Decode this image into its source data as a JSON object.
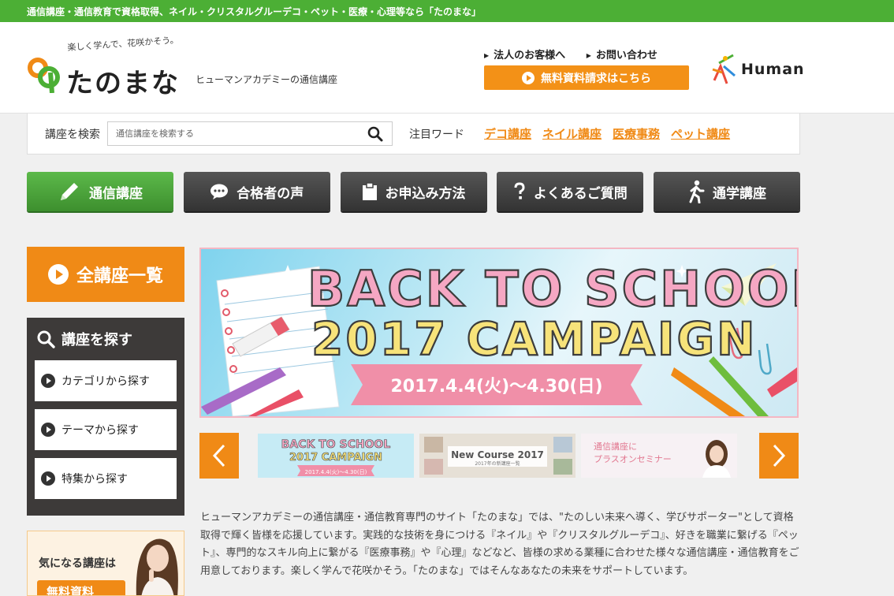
{
  "topbar": {
    "text": "通信講座・通信教育で資格取得、ネイル・クリスタルグルーデコ・ペット・医療・心理等なら「たのまな」"
  },
  "header": {
    "tagline": "楽しく学んで、花咲かそう。",
    "brand": "たのまな",
    "brand_sub": "ヒューマンアカデミーの通信講座",
    "links": [
      {
        "label": "法人のお客様へ"
      },
      {
        "label": "お問い合わせ"
      }
    ],
    "request_button": "無料資料請求はこちら",
    "partner_logo": "Human",
    "colors": {
      "green": "#4caf35",
      "orange": "#f39117"
    }
  },
  "search": {
    "label": "講座を検索",
    "placeholder": "通信講座を検索する",
    "keyword_label": "注目ワード",
    "keywords": [
      "デコ講座",
      "ネイル講座",
      "医療事務",
      "ペット講座"
    ]
  },
  "nav": [
    {
      "label": "通信講座",
      "icon": "pencil-icon",
      "active": true
    },
    {
      "label": "合格者の声",
      "icon": "speech-bubble-icon",
      "active": false
    },
    {
      "label": "お申込み方法",
      "icon": "clipboard-icon",
      "active": false
    },
    {
      "label": "よくあるご質問",
      "icon": "question-icon",
      "active": false
    },
    {
      "label": "通学講座",
      "icon": "walking-person-icon",
      "active": false
    }
  ],
  "sidebar": {
    "all_courses": "全講座一覧",
    "find_title": "講座を探す",
    "find_items": [
      {
        "label": "カテゴリから探す"
      },
      {
        "label": "テーマから探す"
      },
      {
        "label": "特集から探す"
      }
    ],
    "promo_text": "気になる講座は",
    "promo_button": "無料資料"
  },
  "banner": {
    "line1": "BACK TO SCHOOL",
    "line2": "2017 CAMPAIGN",
    "dates": "2017.4.4(火)〜4.30(日)"
  },
  "thumbnails": [
    {
      "line1": "BACK TO SCHOOL",
      "line2": "2017 CAMPAIGN",
      "dates": "2017.4.4(火)〜4.30(日)"
    },
    {
      "title": "New Course 2017",
      "sub": "2017年の新講座一覧"
    },
    {
      "line1": "通信講座に",
      "line2": "プラスオンセミナー"
    }
  ],
  "description": "ヒューマンアカデミーの通信講座・通信教育専門のサイト「たのまな」では、\"たのしい未来へ導く、学びサポーター\"として資格取得で輝く皆様を応援しています。実践的な技術を身につける『ネイル』や『クリスタルグルーデコ』、好きを職業に繋げる『ペット』、専門的なスキル向上に繋がる『医療事務』や『心理』などなど、皆様の求める業種に合わせた様々な通信講座・通信教育をご用意しております。楽しく学んで花咲かそう。「たのまな」ではそんなあなたの未来をサポートしています。"
}
